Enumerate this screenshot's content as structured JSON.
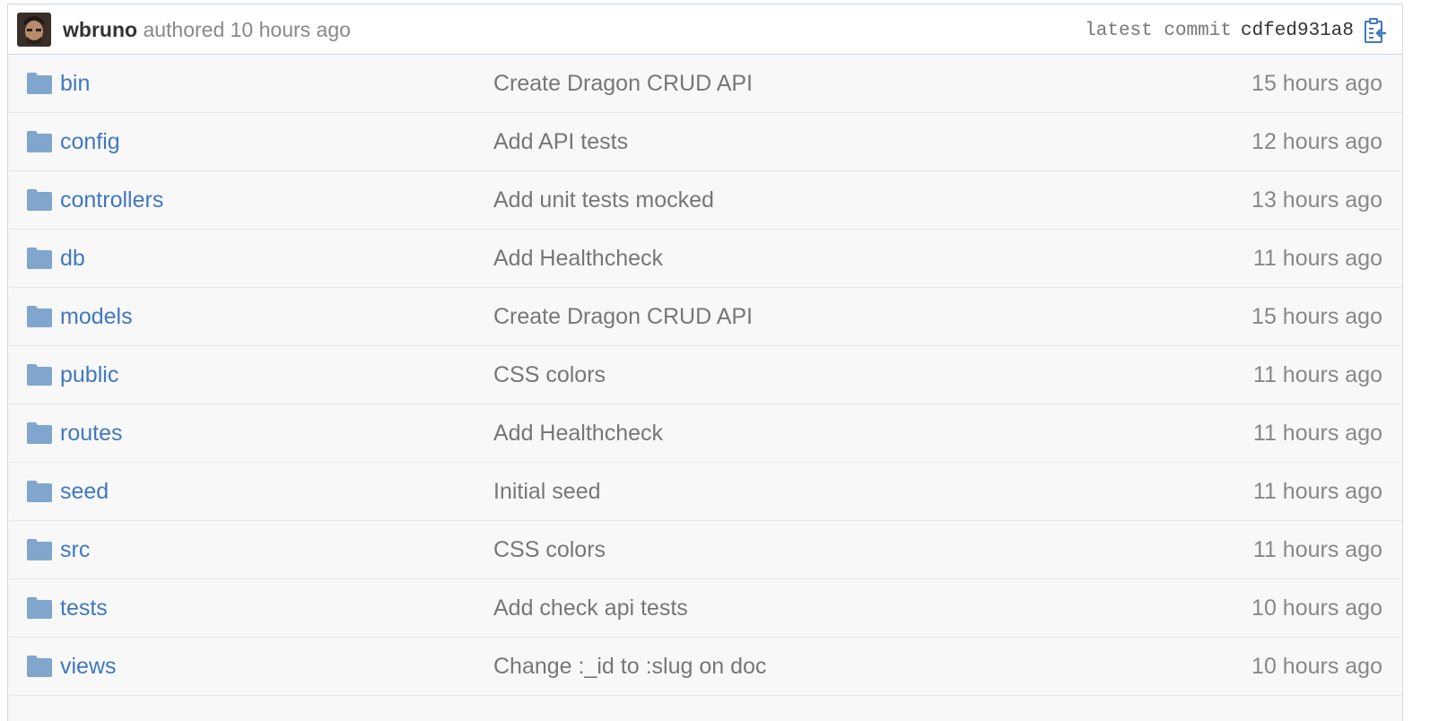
{
  "commit": {
    "author": "wbruno",
    "authored_text": "authored",
    "time": "10 hours ago",
    "latest_label": "latest commit",
    "sha": "cdfed931a8"
  },
  "colors": {
    "link": "#4078c0",
    "folder": "#80a6cd",
    "muted": "#888888",
    "commit_border": "#c7d6e4"
  },
  "files": [
    {
      "name": "bin",
      "type": "folder-icon",
      "message": "Create Dragon CRUD API",
      "age": "15 hours ago"
    },
    {
      "name": "config",
      "type": "folder-icon",
      "message": "Add API tests",
      "age": "12 hours ago"
    },
    {
      "name": "controllers",
      "type": "folder-icon",
      "message": "Add unit tests mocked",
      "age": "13 hours ago"
    },
    {
      "name": "db",
      "type": "folder-icon",
      "message": "Add Healthcheck",
      "age": "11 hours ago"
    },
    {
      "name": "models",
      "type": "folder-icon",
      "message": "Create Dragon CRUD API",
      "age": "15 hours ago"
    },
    {
      "name": "public",
      "type": "folder-icon",
      "message": "CSS colors",
      "age": "11 hours ago"
    },
    {
      "name": "routes",
      "type": "folder-icon",
      "message": "Add Healthcheck",
      "age": "11 hours ago"
    },
    {
      "name": "seed",
      "type": "folder-icon",
      "message": "Initial seed",
      "age": "11 hours ago"
    },
    {
      "name": "src",
      "type": "folder-icon",
      "message": "CSS colors",
      "age": "11 hours ago"
    },
    {
      "name": "tests",
      "type": "folder-icon",
      "message": "Add check api tests",
      "age": "10 hours ago"
    },
    {
      "name": "views",
      "type": "folder-icon",
      "message": "Change :_id to :slug on doc",
      "age": "10 hours ago"
    }
  ]
}
